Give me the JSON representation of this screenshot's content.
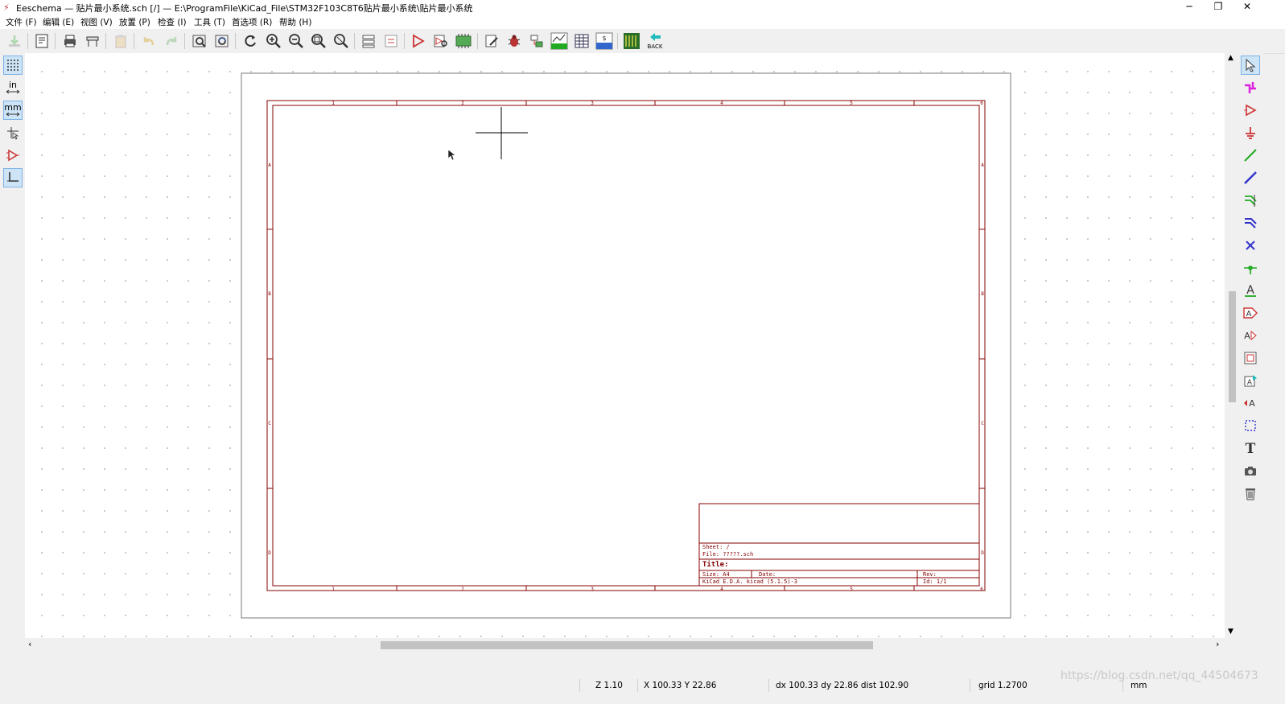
{
  "window": {
    "title": "Eeschema — 贴片最小系统.sch [/] — E:\\ProgramFile\\KiCad_File\\STM32F103C8T6贴片最小系统\\贴片最小系统",
    "minimize_glyph": "─",
    "restore_glyph": "❐",
    "close_glyph": "✕"
  },
  "menu": [
    "文件 (F)",
    "编辑 (E)",
    "视图 (V)",
    "放置 (P)",
    "检查 (I)",
    "工具 (T)",
    "首选项 (R)",
    "帮助 (H)"
  ],
  "toolbar": {
    "net_label": "NET",
    "bom_label": "BOM",
    "back_label": "BACK"
  },
  "left_toolbar": {
    "grid_icon_active": true,
    "inch_label": "in",
    "mm_label": "mm"
  },
  "sheet": {
    "col_labels_top": [
      "1",
      "2",
      "3",
      "4",
      "5",
      "6"
    ],
    "col_labels_bottom": [
      "1",
      "2",
      "3",
      "4",
      "5",
      "6"
    ],
    "row_labels": [
      "A",
      "B",
      "C",
      "D"
    ],
    "title_block": {
      "sheet_line": "Sheet: /",
      "file_line": "File: ?????.sch",
      "title_line": "Title:",
      "size_line": "Size: A4",
      "date_line": "Date:",
      "rev_line": "Rev:",
      "kicad_line": "KiCad E.D.A.  kicad (5.1.5)-3",
      "id_line": "Id: 1/1"
    },
    "border_color": "#840000"
  },
  "status": {
    "zoom": "Z 1.10",
    "xy": "X 100.33  Y 22.86",
    "delta": "dx 100.33  dy 22.86  dist 102.90",
    "grid": "grid 1.2700",
    "units": "mm"
  },
  "watermark": "https://blog.csdn.net/qq_44504673"
}
